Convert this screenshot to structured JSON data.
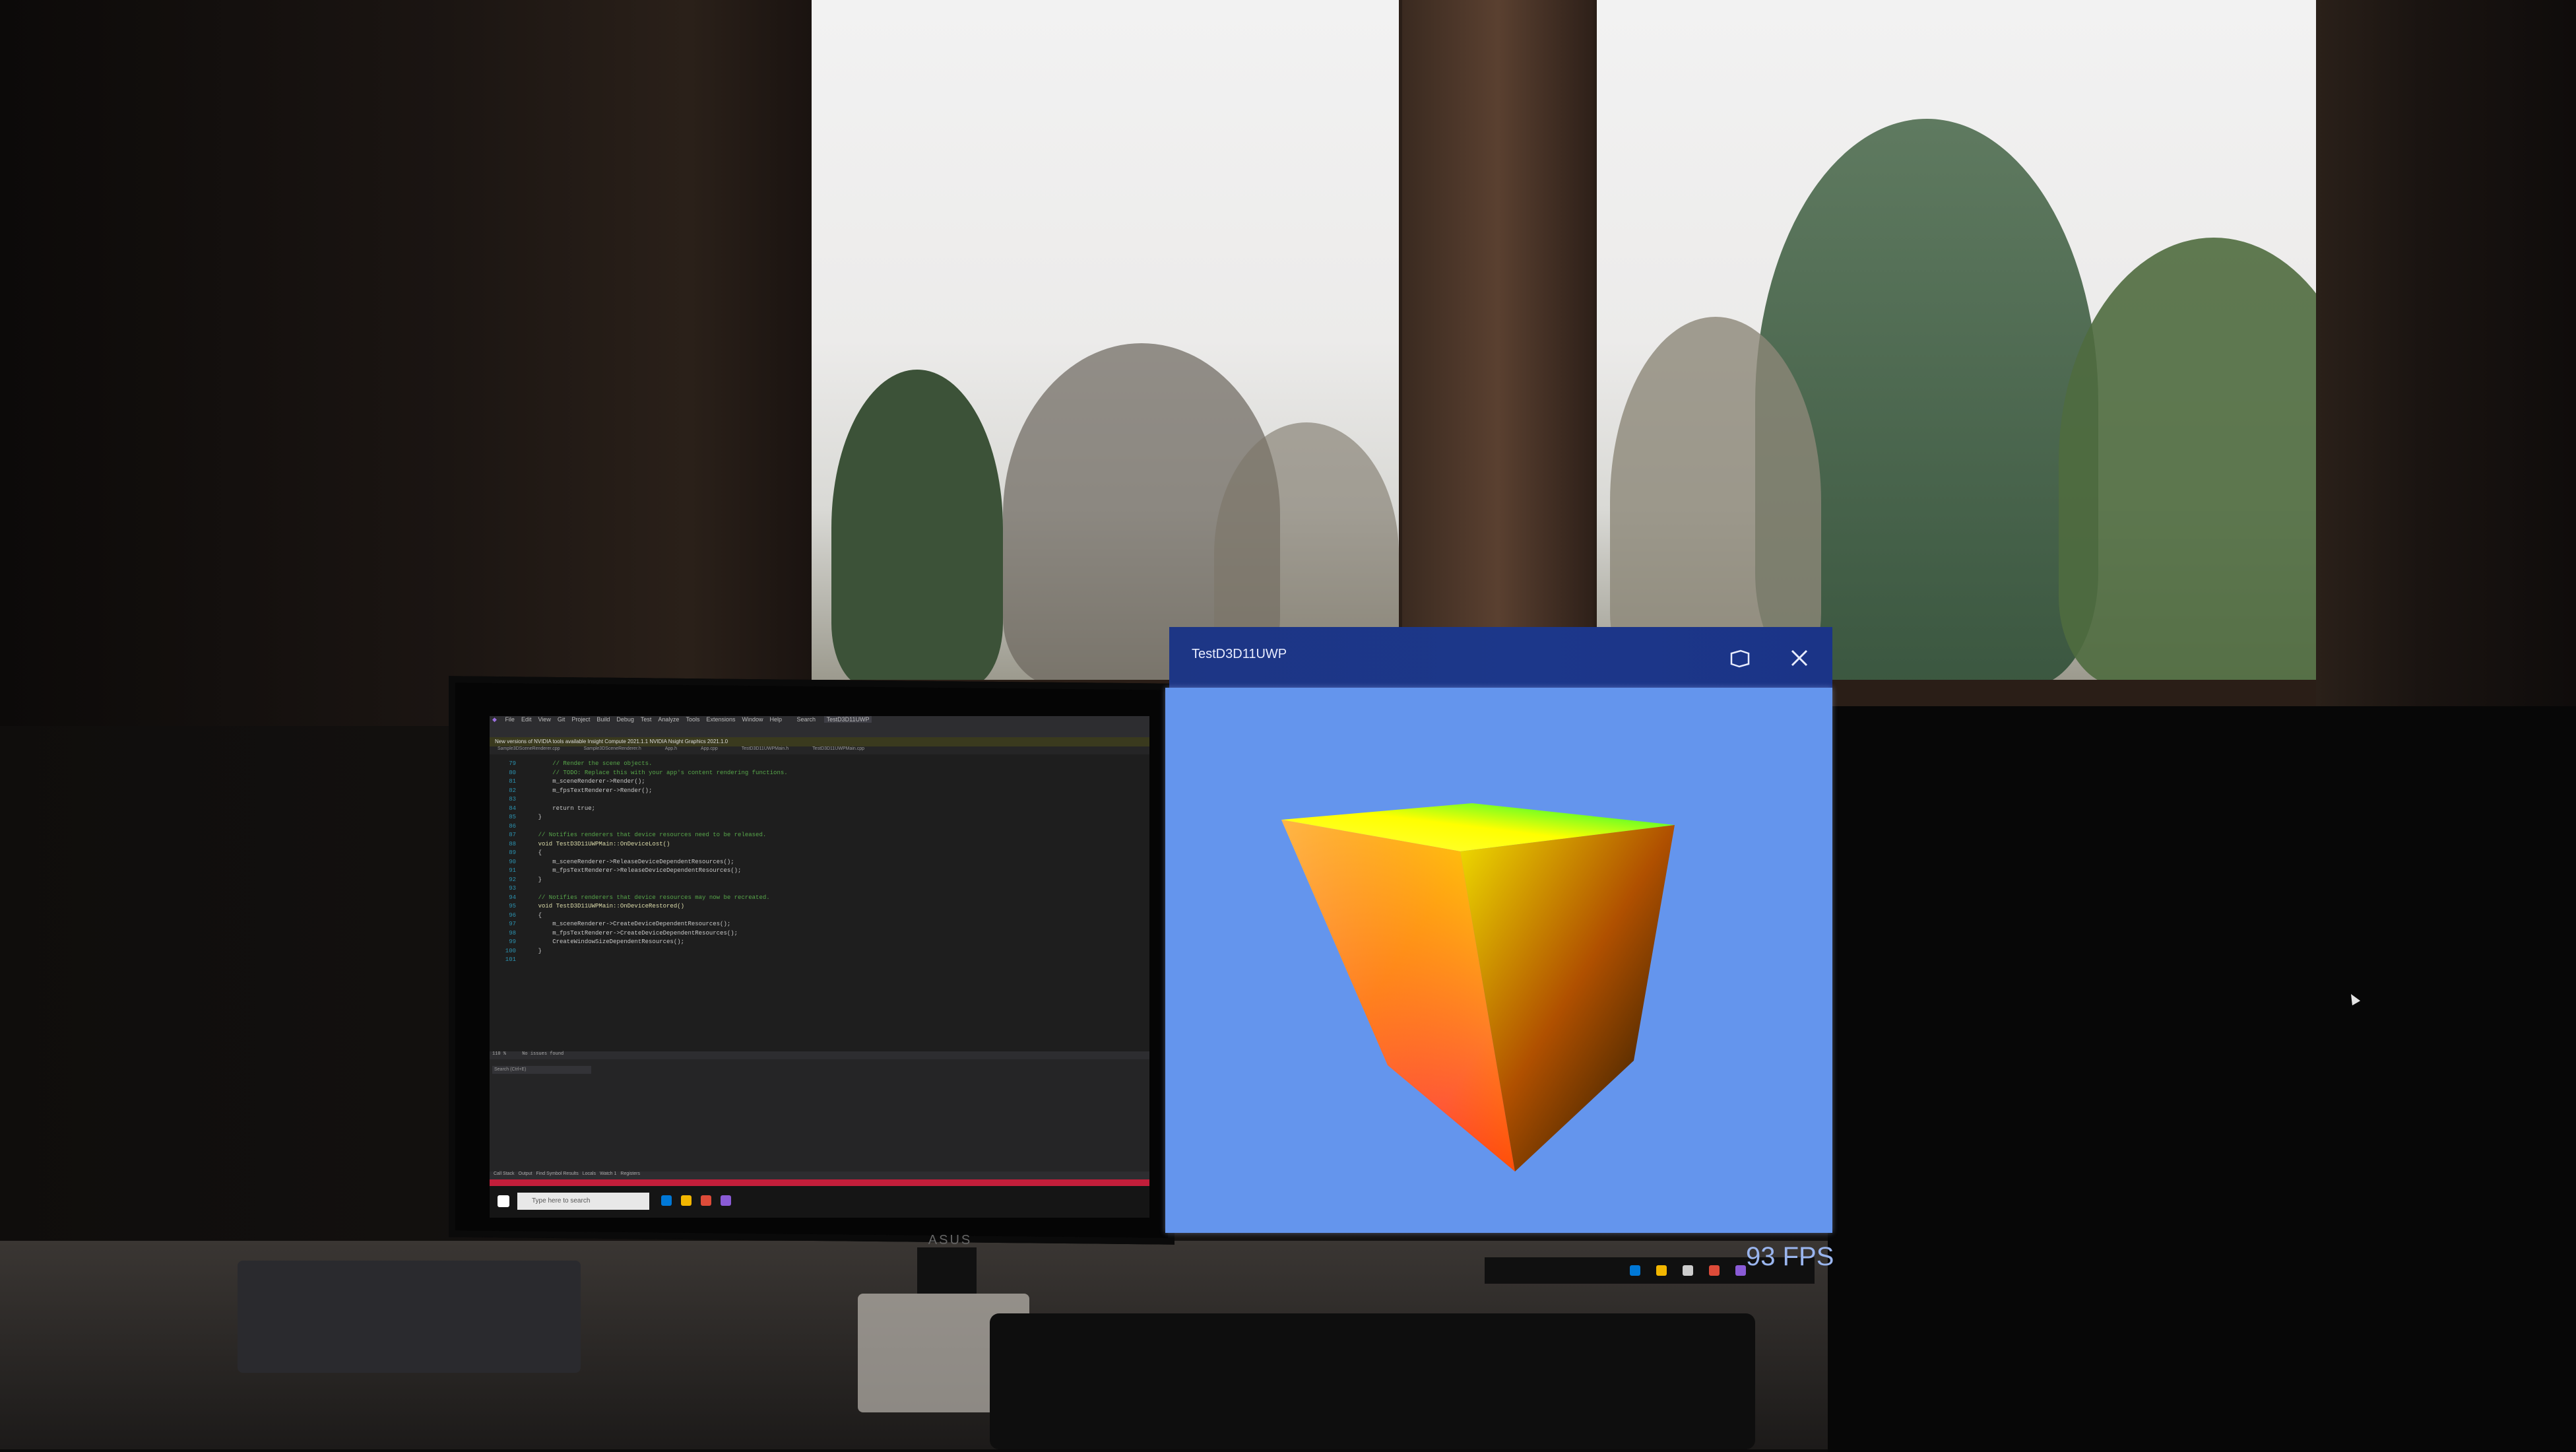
{
  "app_window": {
    "title": "TestD3D11UWP",
    "restore_icon": "restore-window-icon",
    "close_icon": "close-icon",
    "background_color": "#6495ed",
    "fps_label": "93 FPS"
  },
  "ide": {
    "menu": [
      "File",
      "Edit",
      "View",
      "Git",
      "Project",
      "Build",
      "Debug",
      "Test",
      "Analyze",
      "Tools",
      "Extensions",
      "Window",
      "Help"
    ],
    "search_label": "Search",
    "solution_name": "TestD3D11UWP",
    "infobar_text": "New versions of NVIDIA tools available    Insight Compute 2021.1.1    NVIDIA Nsight Graphics 2021.1.0",
    "tabs": [
      "Sample3DSceneRenderer.cpp",
      "Sample3DSceneRenderer.h",
      "App.h",
      "App.cpp",
      "TestD3D11UWPMain.h",
      "TestD3D11UWPMain.cpp"
    ],
    "code_lines": [
      {
        "n": "79",
        "t": "        // Render the scene objects.",
        "c": "cm"
      },
      {
        "n": "80",
        "t": "        // TODO: Replace this with your app's content rendering functions.",
        "c": "cm"
      },
      {
        "n": "81",
        "t": "        m_sceneRenderer->Render();",
        "c": ""
      },
      {
        "n": "82",
        "t": "        m_fpsTextRenderer->Render();",
        "c": ""
      },
      {
        "n": "83",
        "t": "",
        "c": ""
      },
      {
        "n": "84",
        "t": "        return true;",
        "c": ""
      },
      {
        "n": "85",
        "t": "    }",
        "c": ""
      },
      {
        "n": "86",
        "t": "",
        "c": ""
      },
      {
        "n": "87",
        "t": "    // Notifies renderers that device resources need to be released.",
        "c": "cm"
      },
      {
        "n": "88",
        "t": "    void TestD3D11UWPMain::OnDeviceLost()",
        "c": "fn"
      },
      {
        "n": "89",
        "t": "    {",
        "c": ""
      },
      {
        "n": "90",
        "t": "        m_sceneRenderer->ReleaseDeviceDependentResources();",
        "c": ""
      },
      {
        "n": "91",
        "t": "        m_fpsTextRenderer->ReleaseDeviceDependentResources();",
        "c": ""
      },
      {
        "n": "92",
        "t": "    }",
        "c": ""
      },
      {
        "n": "93",
        "t": "",
        "c": ""
      },
      {
        "n": "94",
        "t": "    // Notifies renderers that device resources may now be recreated.",
        "c": "cm"
      },
      {
        "n": "95",
        "t": "    void TestD3D11UWPMain::OnDeviceRestored()",
        "c": "fn"
      },
      {
        "n": "96",
        "t": "    {",
        "c": ""
      },
      {
        "n": "97",
        "t": "        m_sceneRenderer->CreateDeviceDependentResources();",
        "c": ""
      },
      {
        "n": "98",
        "t": "        m_fpsTextRenderer->CreateDeviceDependentResources();",
        "c": ""
      },
      {
        "n": "99",
        "t": "        CreateWindowSizeDependentResources();",
        "c": ""
      },
      {
        "n": "100",
        "t": "    }",
        "c": ""
      },
      {
        "n": "101",
        "t": "",
        "c": ""
      }
    ],
    "status_zoom": "110 %",
    "status_issues": "No issues found",
    "search_box": "Search (Ctrl+E)",
    "bottom_tabs": [
      "Call Stack",
      "Output",
      "Find Symbol Results",
      "Locals",
      "Watch 1",
      "Registers"
    ],
    "taskbar_search": "Type here to search"
  },
  "monitor_brand": "ASUS"
}
